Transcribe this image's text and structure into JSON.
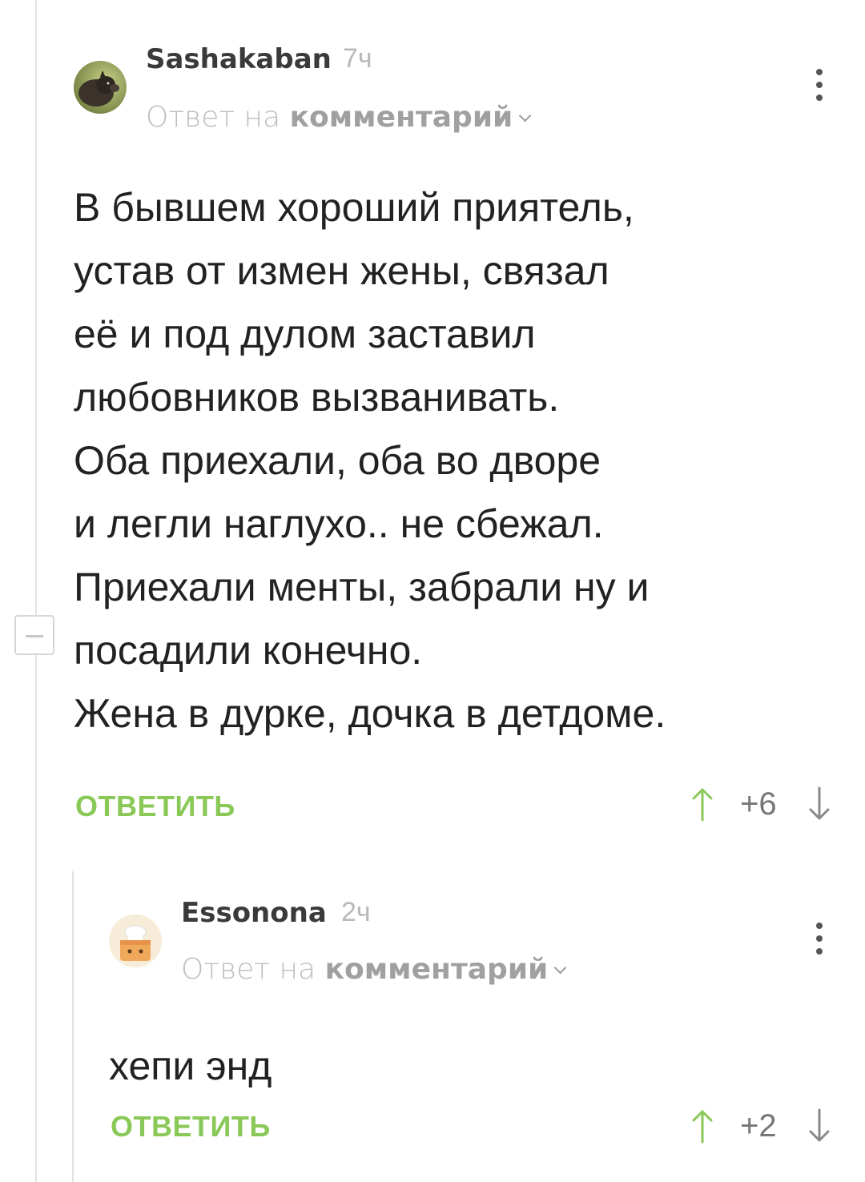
{
  "comments": [
    {
      "author": "Sashakaban",
      "time": "7ч",
      "avatar": "boar-avatar",
      "reply_prefix": "Ответ на",
      "reply_link": "комментарий",
      "text": "В бывшем хороший приятель,\nустав от измен жены, связал\nеё и под дулом заставил\nлюбовников вызванивать.\nОба приехали, оба во дворе\nи легли наглухо.. не сбежал.\nПриехали менты, забрали ну и\nпосадили конечно.\nЖена в дурке, дочка в детдоме.",
      "reply_label": "ОТВЕТИТЬ",
      "score": "+6"
    },
    {
      "author": "Essonona",
      "time": "2ч",
      "avatar": "chef-avatar",
      "reply_prefix": "Ответ на",
      "reply_link": "комментарий",
      "text": "хепи энд",
      "reply_label": "ОТВЕТИТЬ",
      "score": "+2"
    }
  ],
  "colors": {
    "accent_green": "#8ac858",
    "thread_line": "#e2e2e2",
    "text": "#222222",
    "muted": "#b5b5b5"
  },
  "icons": [
    "collapse-icon",
    "more-vertical-icon",
    "arrow-up-icon",
    "arrow-down-icon",
    "chevron-down-icon"
  ]
}
